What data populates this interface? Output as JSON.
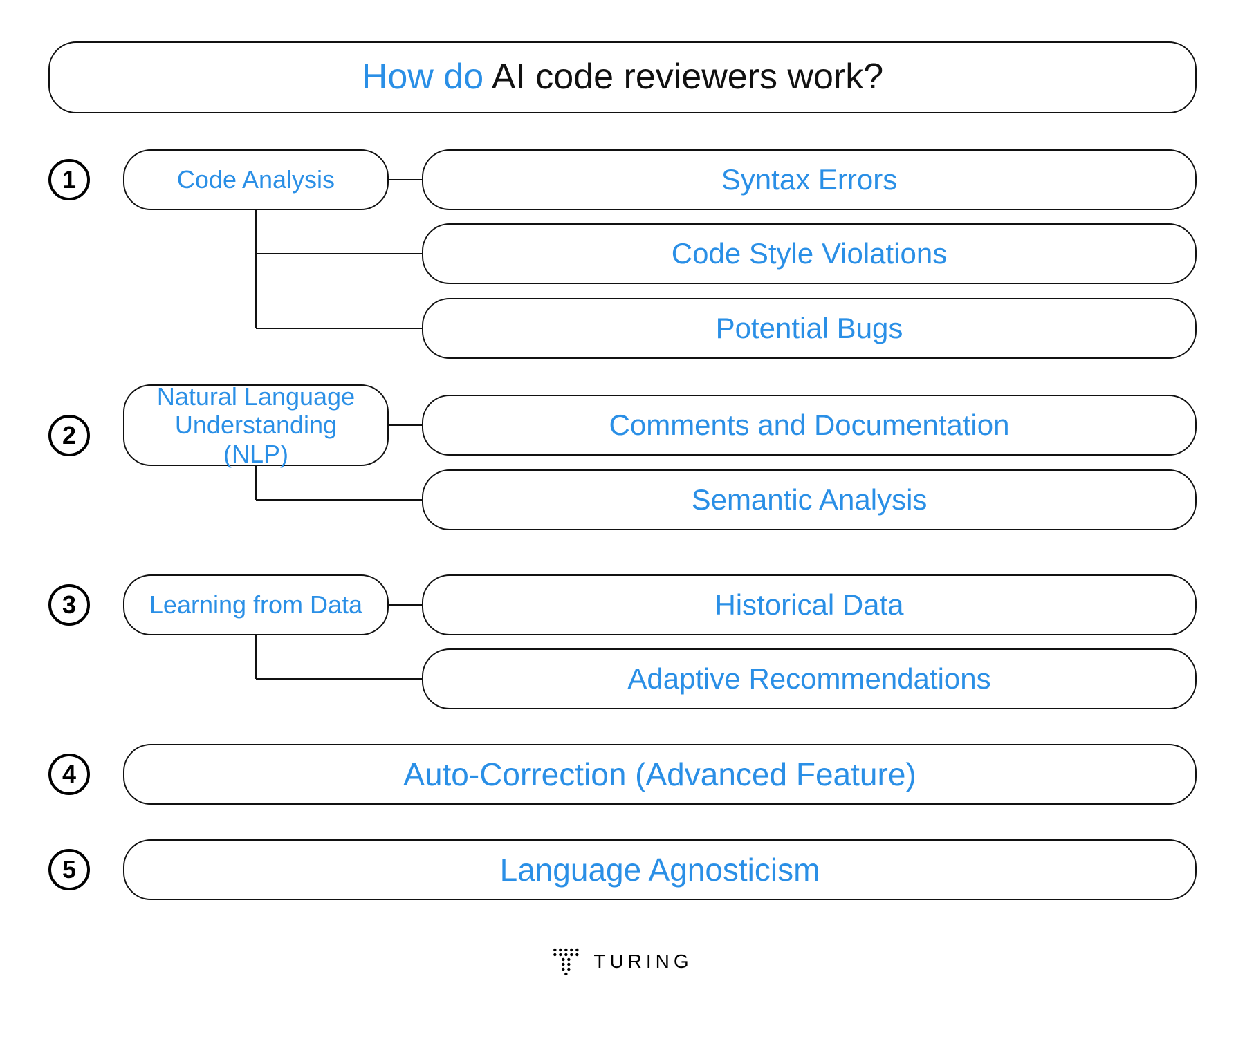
{
  "title": {
    "accent": "How do ",
    "rest": "AI code reviewers work?"
  },
  "colors": {
    "accent": "#2a8fe6",
    "border": "#111111",
    "text": "#111111"
  },
  "steps": [
    {
      "num": "1",
      "label": "Code Analysis",
      "children": [
        "Syntax Errors",
        "Code Style Violations",
        "Potential Bugs"
      ]
    },
    {
      "num": "2",
      "label": "Natural Language Understanding (NLP)",
      "children": [
        "Comments and Documentation",
        "Semantic Analysis"
      ]
    },
    {
      "num": "3",
      "label": "Learning from Data",
      "children": [
        "Historical Data",
        "Adaptive Recommendations"
      ]
    },
    {
      "num": "4",
      "label": "Auto-Correction (Advanced Feature)",
      "children": []
    },
    {
      "num": "5",
      "label": "Language Agnosticism",
      "children": []
    }
  ],
  "brand": "TURING"
}
